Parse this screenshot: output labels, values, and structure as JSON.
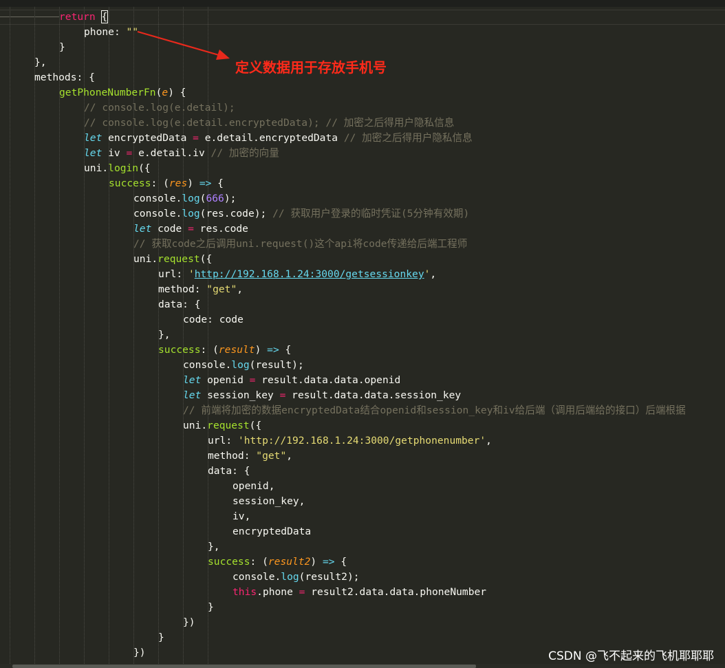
{
  "annotation": {
    "text": "定义数据用于存放手机号",
    "color": "#ff2a1a"
  },
  "watermark": "CSDN @飞不起来的飞机耶耶耶",
  "theme": {
    "background": "#272822",
    "keyword": "#f92672",
    "function": "#a6e22e",
    "string": "#e6db74",
    "comment": "#75715e",
    "type": "#66d9ef",
    "param": "#fd971f",
    "number": "#ae81ff"
  },
  "code_lines": [
    {
      "indent": 2,
      "tokens": [
        {
          "t": "return",
          "c": "kw"
        },
        {
          "t": " ",
          "c": "pl"
        },
        {
          "t": "{",
          "c": "pl"
        }
      ]
    },
    {
      "indent": 3,
      "tokens": [
        {
          "t": "phone",
          "c": "pr"
        },
        {
          "t": ": ",
          "c": "pl"
        },
        {
          "t": "\"\"",
          "c": "st"
        }
      ]
    },
    {
      "indent": 2,
      "tokens": [
        {
          "t": "}",
          "c": "pl"
        }
      ]
    },
    {
      "indent": 1,
      "tokens": [
        {
          "t": "},",
          "c": "pl"
        }
      ]
    },
    {
      "indent": 1,
      "tokens": [
        {
          "t": "methods",
          "c": "pr"
        },
        {
          "t": ": {",
          "c": "pl"
        }
      ]
    },
    {
      "indent": 2,
      "tokens": [
        {
          "t": "getPhoneNumberFn",
          "c": "fn"
        },
        {
          "t": "(",
          "c": "pl"
        },
        {
          "t": "e",
          "c": "ps"
        },
        {
          "t": ") {",
          "c": "pl"
        }
      ]
    },
    {
      "indent": 3,
      "tokens": [
        {
          "t": "// console.log(e.detail);",
          "c": "cm"
        }
      ]
    },
    {
      "indent": 3,
      "tokens": [
        {
          "t": "// console.log(e.detail.encryptedData); // 加密之后得用户隐私信息",
          "c": "cm"
        }
      ]
    },
    {
      "indent": 3,
      "tokens": [
        {
          "t": "let",
          "c": "tp"
        },
        {
          "t": " encryptedData ",
          "c": "pl"
        },
        {
          "t": "=",
          "c": "op"
        },
        {
          "t": " e.detail.encryptedData ",
          "c": "pl"
        },
        {
          "t": "// 加密之后得用户隐私信息",
          "c": "cm"
        }
      ]
    },
    {
      "indent": 3,
      "tokens": [
        {
          "t": "let",
          "c": "tp"
        },
        {
          "t": " iv ",
          "c": "pl"
        },
        {
          "t": "=",
          "c": "op"
        },
        {
          "t": " e.detail.iv ",
          "c": "pl"
        },
        {
          "t": "// 加密的向量",
          "c": "cm"
        }
      ]
    },
    {
      "indent": 3,
      "tokens": [
        {
          "t": "uni.",
          "c": "pl"
        },
        {
          "t": "login",
          "c": "fn"
        },
        {
          "t": "({",
          "c": "pl"
        }
      ]
    },
    {
      "indent": 4,
      "tokens": [
        {
          "t": "success",
          "c": "fn"
        },
        {
          "t": ": (",
          "c": "pl"
        },
        {
          "t": "res",
          "c": "ps"
        },
        {
          "t": ") ",
          "c": "pl"
        },
        {
          "t": "=>",
          "c": "tp"
        },
        {
          "t": " {",
          "c": "pl"
        }
      ]
    },
    {
      "indent": 5,
      "tokens": [
        {
          "t": "console.",
          "c": "pl"
        },
        {
          "t": "log",
          "c": "mt"
        },
        {
          "t": "(",
          "c": "pl"
        },
        {
          "t": "666",
          "c": "nm"
        },
        {
          "t": ");",
          "c": "pl"
        }
      ]
    },
    {
      "indent": 5,
      "tokens": [
        {
          "t": "console.",
          "c": "pl"
        },
        {
          "t": "log",
          "c": "mt"
        },
        {
          "t": "(res.code); ",
          "c": "pl"
        },
        {
          "t": "// 获取用户登录的临时凭证(5分钟有效期)",
          "c": "cm"
        }
      ]
    },
    {
      "indent": 5,
      "tokens": [
        {
          "t": "let",
          "c": "tp"
        },
        {
          "t": " code ",
          "c": "pl"
        },
        {
          "t": "=",
          "c": "op"
        },
        {
          "t": " res.code",
          "c": "pl"
        }
      ]
    },
    {
      "indent": 5,
      "tokens": [
        {
          "t": "// 获取code之后调用uni.request()这个api将code传递给后端工程师",
          "c": "cm"
        }
      ]
    },
    {
      "indent": 5,
      "tokens": [
        {
          "t": "uni.",
          "c": "pl"
        },
        {
          "t": "request",
          "c": "fn"
        },
        {
          "t": "({",
          "c": "pl"
        }
      ]
    },
    {
      "indent": 6,
      "tokens": [
        {
          "t": "url",
          "c": "pr"
        },
        {
          "t": ": ",
          "c": "pl"
        },
        {
          "t": "'",
          "c": "st"
        },
        {
          "t": "http://192.168.1.24:3000/getsessionkey",
          "c": "lk"
        },
        {
          "t": "'",
          "c": "st"
        },
        {
          "t": ",",
          "c": "pl"
        }
      ]
    },
    {
      "indent": 6,
      "tokens": [
        {
          "t": "method",
          "c": "pr"
        },
        {
          "t": ": ",
          "c": "pl"
        },
        {
          "t": "\"get\"",
          "c": "st"
        },
        {
          "t": ",",
          "c": "pl"
        }
      ]
    },
    {
      "indent": 6,
      "tokens": [
        {
          "t": "data",
          "c": "pr"
        },
        {
          "t": ": {",
          "c": "pl"
        }
      ]
    },
    {
      "indent": 7,
      "tokens": [
        {
          "t": "code",
          "c": "pr"
        },
        {
          "t": ": code",
          "c": "pl"
        }
      ]
    },
    {
      "indent": 6,
      "tokens": [
        {
          "t": "},",
          "c": "pl"
        }
      ]
    },
    {
      "indent": 6,
      "tokens": [
        {
          "t": "success",
          "c": "fn"
        },
        {
          "t": ": (",
          "c": "pl"
        },
        {
          "t": "result",
          "c": "ps"
        },
        {
          "t": ") ",
          "c": "pl"
        },
        {
          "t": "=>",
          "c": "tp"
        },
        {
          "t": " {",
          "c": "pl"
        }
      ]
    },
    {
      "indent": 7,
      "tokens": [
        {
          "t": "console.",
          "c": "pl"
        },
        {
          "t": "log",
          "c": "mt"
        },
        {
          "t": "(result);",
          "c": "pl"
        }
      ]
    },
    {
      "indent": 7,
      "tokens": [
        {
          "t": "let",
          "c": "tp"
        },
        {
          "t": " openid ",
          "c": "pl"
        },
        {
          "t": "=",
          "c": "op"
        },
        {
          "t": " result.data.data.openid",
          "c": "pl"
        }
      ]
    },
    {
      "indent": 7,
      "tokens": [
        {
          "t": "let",
          "c": "tp"
        },
        {
          "t": " session_key ",
          "c": "pl"
        },
        {
          "t": "=",
          "c": "op"
        },
        {
          "t": " result.data.data.session_key",
          "c": "pl"
        }
      ]
    },
    {
      "indent": 7,
      "tokens": [
        {
          "t": "// 前端将加密的数据encryptedData结合openid和session_key和iv给后端（调用后端给的接口）后端根据",
          "c": "cm"
        }
      ]
    },
    {
      "indent": 7,
      "tokens": [
        {
          "t": "uni.",
          "c": "pl"
        },
        {
          "t": "request",
          "c": "fn"
        },
        {
          "t": "({",
          "c": "pl"
        }
      ]
    },
    {
      "indent": 8,
      "tokens": [
        {
          "t": "url",
          "c": "pr"
        },
        {
          "t": ": ",
          "c": "pl"
        },
        {
          "t": "'http://192.168.1.24:3000/getphonenumber'",
          "c": "st"
        },
        {
          "t": ",",
          "c": "pl"
        }
      ]
    },
    {
      "indent": 8,
      "tokens": [
        {
          "t": "method",
          "c": "pr"
        },
        {
          "t": ": ",
          "c": "pl"
        },
        {
          "t": "\"get\"",
          "c": "st"
        },
        {
          "t": ",",
          "c": "pl"
        }
      ]
    },
    {
      "indent": 8,
      "tokens": [
        {
          "t": "data",
          "c": "pr"
        },
        {
          "t": ": {",
          "c": "pl"
        }
      ]
    },
    {
      "indent": 9,
      "tokens": [
        {
          "t": "openid,",
          "c": "pl"
        }
      ]
    },
    {
      "indent": 9,
      "tokens": [
        {
          "t": "session_key,",
          "c": "pl"
        }
      ]
    },
    {
      "indent": 9,
      "tokens": [
        {
          "t": "iv,",
          "c": "pl"
        }
      ]
    },
    {
      "indent": 9,
      "tokens": [
        {
          "t": "encryptedData",
          "c": "pl"
        }
      ]
    },
    {
      "indent": 8,
      "tokens": [
        {
          "t": "},",
          "c": "pl"
        }
      ]
    },
    {
      "indent": 8,
      "tokens": [
        {
          "t": "success",
          "c": "fn"
        },
        {
          "t": ": (",
          "c": "pl"
        },
        {
          "t": "result2",
          "c": "ps"
        },
        {
          "t": ") ",
          "c": "pl"
        },
        {
          "t": "=>",
          "c": "tp"
        },
        {
          "t": " {",
          "c": "pl"
        }
      ]
    },
    {
      "indent": 9,
      "tokens": [
        {
          "t": "console.",
          "c": "pl"
        },
        {
          "t": "log",
          "c": "mt"
        },
        {
          "t": "(result2);",
          "c": "pl"
        }
      ]
    },
    {
      "indent": 9,
      "tokens": [
        {
          "t": "this",
          "c": "kw"
        },
        {
          "t": ".phone ",
          "c": "pl"
        },
        {
          "t": "=",
          "c": "op"
        },
        {
          "t": " result2.data.data.phoneNumber",
          "c": "pl"
        }
      ]
    },
    {
      "indent": 8,
      "tokens": [
        {
          "t": "}",
          "c": "pl"
        }
      ]
    },
    {
      "indent": 7,
      "tokens": [
        {
          "t": "})",
          "c": "pl"
        }
      ]
    },
    {
      "indent": 6,
      "tokens": [
        {
          "t": "}",
          "c": "pl"
        }
      ]
    },
    {
      "indent": 5,
      "tokens": [
        {
          "t": "})",
          "c": "pl"
        }
      ]
    }
  ]
}
